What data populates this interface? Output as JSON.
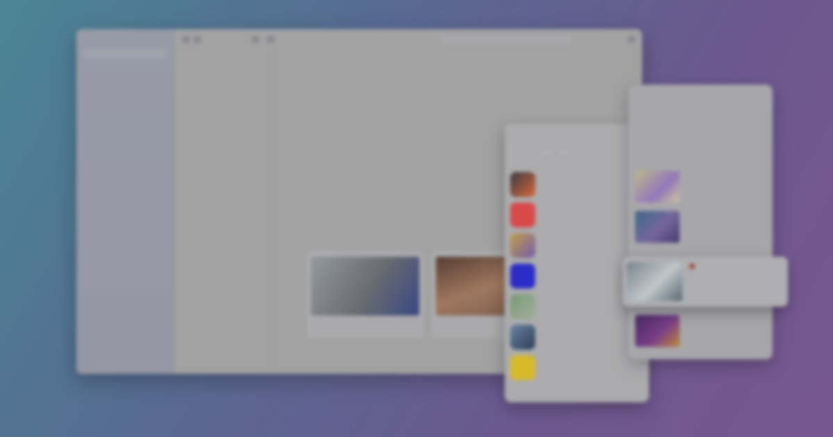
{
  "sidebar": {
    "title": "",
    "search_placeholder": "",
    "footer": ""
  },
  "browser": {
    "url": "",
    "empty_state": ""
  },
  "cards": [
    {
      "meta": "",
      "colors": [
        "#9aa0a5",
        "#6d6f73"
      ]
    },
    {
      "meta": "",
      "colors": [
        "#7a5a4b",
        "#a67d62"
      ]
    }
  ],
  "panel": {
    "header": "",
    "chips": [
      "",
      ""
    ],
    "items": [
      {
        "title": "",
        "subtitle": "",
        "color": "#e06a3a"
      },
      {
        "title": "",
        "subtitle": "",
        "color": "#e24b4b"
      },
      {
        "title": "",
        "subtitle": "",
        "color": "#c8a54a"
      },
      {
        "title": "",
        "subtitle": "",
        "color": "#2d2dd1"
      },
      {
        "title": "",
        "subtitle": "",
        "color": "#7fa07d"
      },
      {
        "title": "",
        "subtitle": "",
        "color": "#6d8aa8"
      },
      {
        "title": "",
        "subtitle": "",
        "color": "#e0c22a"
      }
    ]
  },
  "panel2": {
    "header": "",
    "tabs": [
      "",
      ""
    ],
    "segment": [
      "",
      ""
    ],
    "items": [
      {
        "title": "",
        "color": "#c4c18e"
      },
      {
        "title": "",
        "color": "#7a6aa3"
      },
      {
        "title": "",
        "color": "#7b3f8c"
      }
    ]
  },
  "floating_card": {
    "title": "",
    "action": ""
  }
}
